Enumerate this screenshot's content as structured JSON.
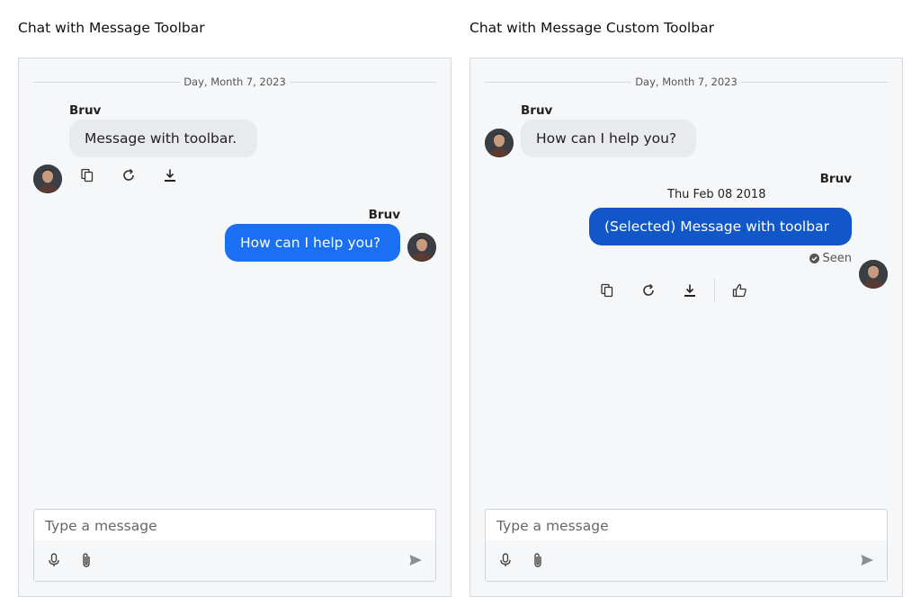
{
  "panels": [
    {
      "title": "Chat with Message Toolbar",
      "date_divider": "Day, Month 7, 2023",
      "incoming": {
        "sender": "Bruv",
        "text": "Message with toolbar."
      },
      "outgoing": {
        "sender": "Bruv",
        "text": "How can I help you?"
      },
      "toolbar": [
        "copy-icon",
        "refresh-icon",
        "download-icon"
      ],
      "composer": {
        "placeholder": "Type a message",
        "value": ""
      }
    },
    {
      "title": "Chat with Message Custom Toolbar",
      "date_divider": "Day, Month 7, 2023",
      "incoming": {
        "sender": "Bruv",
        "text": "How can I help you?"
      },
      "outgoing": {
        "sender": "Bruv",
        "timestamp": "Thu Feb 08 2018",
        "text": "(Selected) Message with toolbar",
        "status": "Seen"
      },
      "toolbar": [
        "copy-icon",
        "refresh-icon",
        "download-icon",
        "thumbs-up-icon"
      ],
      "composer": {
        "placeholder": "Type a message",
        "value": ""
      }
    }
  ],
  "colors": {
    "incoming_bubble": "#e8eaed",
    "outgoing_bubble": "#1a6ff2",
    "selected_bubble": "#1257c9",
    "panel_background": "#f6f7f9"
  }
}
